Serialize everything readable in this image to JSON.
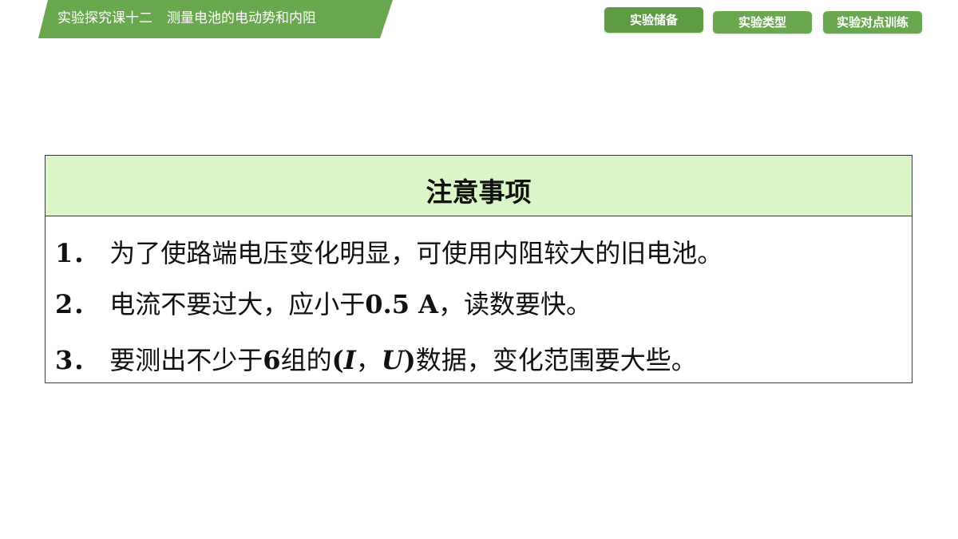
{
  "header": {
    "course": "实验探究课十二",
    "topic": "测量电池的电动势和内阻"
  },
  "nav": {
    "tabs": [
      {
        "label": "实验储备"
      },
      {
        "label": "实验类型"
      },
      {
        "label": "实验对点训练"
      }
    ]
  },
  "notes": {
    "title": "注意事项",
    "items": [
      {
        "num": "1．",
        "text": "为了使路端电压变化明显，可使用内阻较大的旧电池。"
      },
      {
        "num": "2．",
        "pre": "电流不要过大，应小于",
        "value": "0.5 A",
        "post": "，读数要快。"
      },
      {
        "num": "3．",
        "pre": "要测出不少于",
        "count": "6",
        "mid": "组的",
        "paren_open": "(",
        "var_i": "I",
        "comma": "，",
        "var_u": "U",
        "paren_close": ")",
        "post": "数据，变化范围要大些。"
      }
    ]
  },
  "colors": {
    "banner_green": "#6aa84f",
    "header_fill": "#daf5c6",
    "border": "#3a3a3a"
  }
}
